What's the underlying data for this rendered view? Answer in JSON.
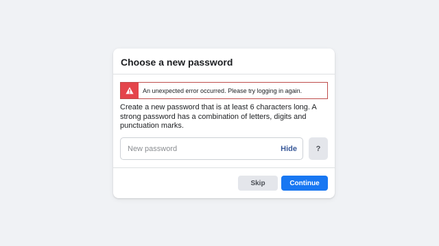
{
  "dialog": {
    "title": "Choose a new password",
    "error_message": "An unexpected error occurred. Please try logging in again.",
    "description": "Create a new password that is at least 6 characters long. A strong password has a combination of letters, digits and punctuation marks.",
    "password_field": {
      "value": "",
      "placeholder": "New password",
      "toggle_label": "Hide"
    },
    "help_label": "?",
    "skip_label": "Skip",
    "continue_label": "Continue"
  },
  "icons": {
    "error": "warning-icon"
  },
  "colors": {
    "background": "#f0f2f5",
    "error_accent": "#e4454b",
    "primary": "#1877f2",
    "link": "#385898",
    "secondary_button": "#e4e6eb"
  }
}
